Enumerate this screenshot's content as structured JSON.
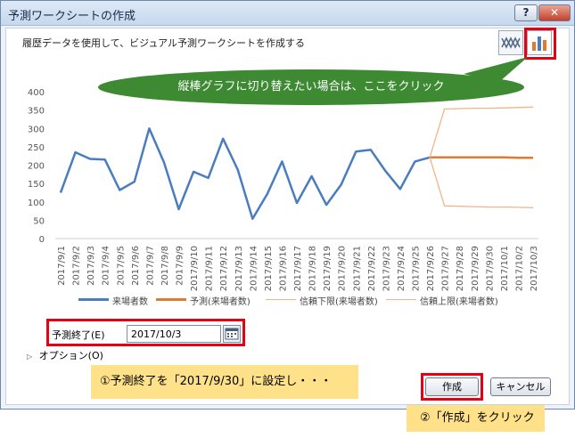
{
  "window": {
    "title": "予測ワークシートの作成",
    "help_label": "?",
    "close_label": "✕"
  },
  "description": "履歴データを使用して、ビジュアル予測ワークシートを作成する",
  "chart_type_buttons": [
    {
      "name": "line-chart-icon",
      "selected": false
    },
    {
      "name": "column-chart-icon",
      "selected": true
    }
  ],
  "callout": "縦棒グラフに切り替えたい場合は、ここをクリック",
  "colors": {
    "actual": "#4a7cc0",
    "forecast": "#e07b2e",
    "bound": "#f2b48a",
    "callout_bg": "#3d8a33",
    "note_bg": "#ffe18a",
    "highlight": "#e60012"
  },
  "chart_data": {
    "type": "line",
    "title": "",
    "xlabel": "",
    "ylabel": "",
    "ylim": [
      0,
      400
    ],
    "yticks": [
      0,
      50,
      100,
      150,
      200,
      250,
      300,
      350,
      400
    ],
    "grid": false,
    "legend_position": "bottom",
    "categories": [
      "2017/9/1",
      "2017/9/2",
      "2017/9/3",
      "2017/9/4",
      "2017/9/5",
      "2017/9/6",
      "2017/9/7",
      "2017/9/8",
      "2017/9/9",
      "2017/9/10",
      "2017/9/11",
      "2017/9/12",
      "2017/9/13",
      "2017/9/14",
      "2017/9/15",
      "2017/9/16",
      "2017/9/17",
      "2017/9/18",
      "2017/9/19",
      "2017/9/20",
      "2017/9/21",
      "2017/9/22",
      "2017/9/23",
      "2017/9/24",
      "2017/9/25",
      "2017/9/26",
      "2017/9/27",
      "2017/9/28",
      "2017/9/29",
      "2017/9/30",
      "2017/10/1",
      "2017/10/2",
      "2017/10/3"
    ],
    "series": [
      {
        "name": "来場者数",
        "color": "#4a7cc0",
        "values": [
          125,
          235,
          217,
          215,
          132,
          155,
          300,
          208,
          80,
          182,
          165,
          272,
          187,
          54,
          122,
          210,
          97,
          170,
          92,
          147,
          237,
          242,
          184,
          135,
          210,
          221,
          null,
          null,
          null,
          null,
          null,
          null,
          null
        ]
      },
      {
        "name": "予測(来場者数)",
        "color": "#e07b2e",
        "values": [
          null,
          null,
          null,
          null,
          null,
          null,
          null,
          null,
          null,
          null,
          null,
          null,
          null,
          null,
          null,
          null,
          null,
          null,
          null,
          null,
          null,
          null,
          null,
          null,
          null,
          221,
          221,
          221,
          221,
          221,
          221,
          220,
          220
        ]
      },
      {
        "name": "信頼下限(来場者数)",
        "color": "#f2b48a",
        "values": [
          null,
          null,
          null,
          null,
          null,
          null,
          null,
          null,
          null,
          null,
          null,
          null,
          null,
          null,
          null,
          null,
          null,
          null,
          null,
          null,
          null,
          null,
          null,
          null,
          null,
          221,
          89,
          88,
          87,
          86,
          86,
          85,
          84
        ]
      },
      {
        "name": "信頼上限(来場者数)",
        "color": "#f2b48a",
        "values": [
          null,
          null,
          null,
          null,
          null,
          null,
          null,
          null,
          null,
          null,
          null,
          null,
          null,
          null,
          null,
          null,
          null,
          null,
          null,
          null,
          null,
          null,
          null,
          null,
          null,
          221,
          353,
          354,
          355,
          355,
          356,
          357,
          358
        ]
      }
    ]
  },
  "forecast_end": {
    "label": "予測終了(E)",
    "value": "2017/10/3"
  },
  "options_label": "オプション(O)",
  "notes": {
    "step1": "①予測終了を「2017/9/30」に設定し・・・",
    "step2": "②「作成」をクリック"
  },
  "buttons": {
    "create": "作成",
    "cancel": "キャンセル"
  }
}
